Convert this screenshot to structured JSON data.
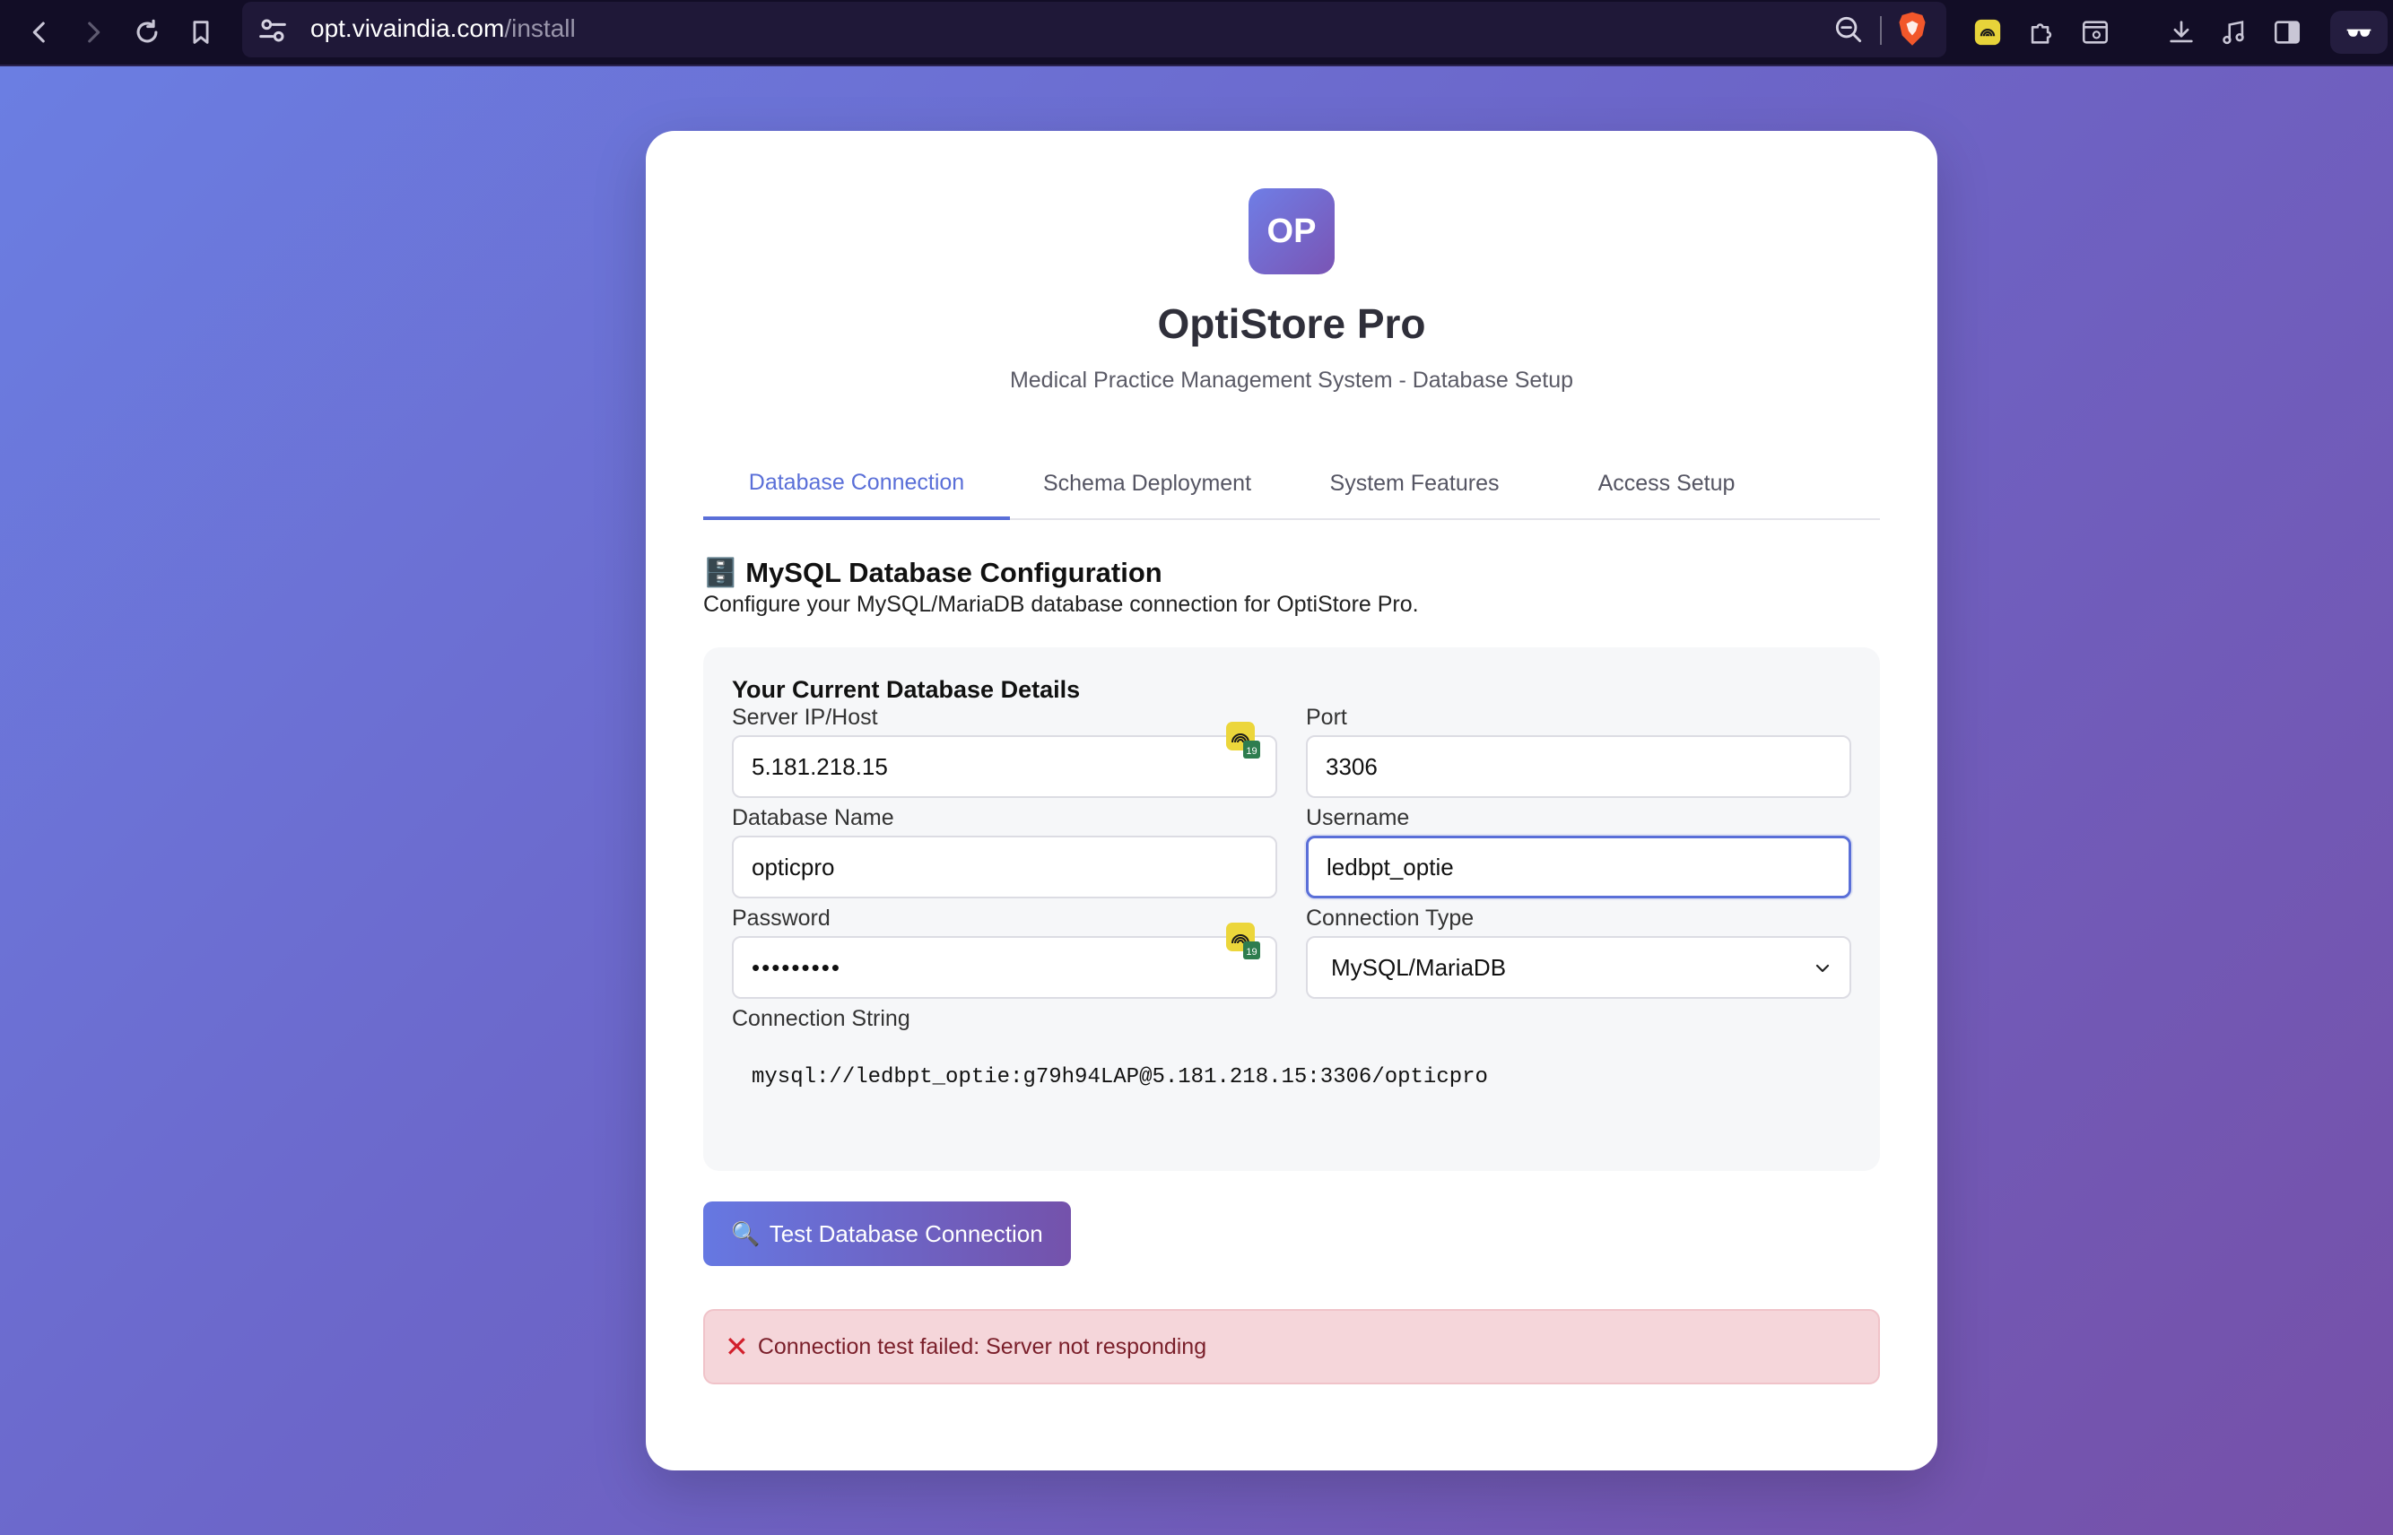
{
  "browser": {
    "url_host": "opt.vivaindia.com",
    "url_path": "/install"
  },
  "app": {
    "logo_text": "OP",
    "title": "OptiStore Pro",
    "subtitle": "Medical Practice Management System - Database Setup"
  },
  "tabs": [
    {
      "label": "Database Connection",
      "active": true
    },
    {
      "label": "Schema Deployment",
      "active": false
    },
    {
      "label": "System Features",
      "active": false
    },
    {
      "label": "Access Setup",
      "active": false
    }
  ],
  "section": {
    "icon": "🗄️",
    "title": "MySQL Database Configuration",
    "description": "Configure your MySQL/MariaDB database connection for OptiStore Pro."
  },
  "details": {
    "heading": "Your Current Database Details",
    "server_label": "Server IP/Host",
    "server_value": "5.181.218.15",
    "port_label": "Port",
    "port_value": "3306",
    "dbname_label": "Database Name",
    "dbname_value": "opticpro",
    "username_label": "Username",
    "username_value": "ledbpt_optie",
    "password_label": "Password",
    "password_value": "•••••••••",
    "conntype_label": "Connection Type",
    "conntype_value": "MySQL/MariaDB",
    "connstring_label": "Connection String",
    "connstring_value": "mysql://ledbpt_optie:g79h94LAP@5.181.218.15:3306/opticpro",
    "extension_badge_count": "19"
  },
  "actions": {
    "test_icon": "🔍",
    "test_label": "Test Database Connection"
  },
  "alert": {
    "icon": "✕",
    "message": "Connection test failed: Server not responding"
  },
  "colors": {
    "accent": "#5a6fd8",
    "error_bg": "#f5d6da",
    "error_text": "#7a1f2a"
  }
}
